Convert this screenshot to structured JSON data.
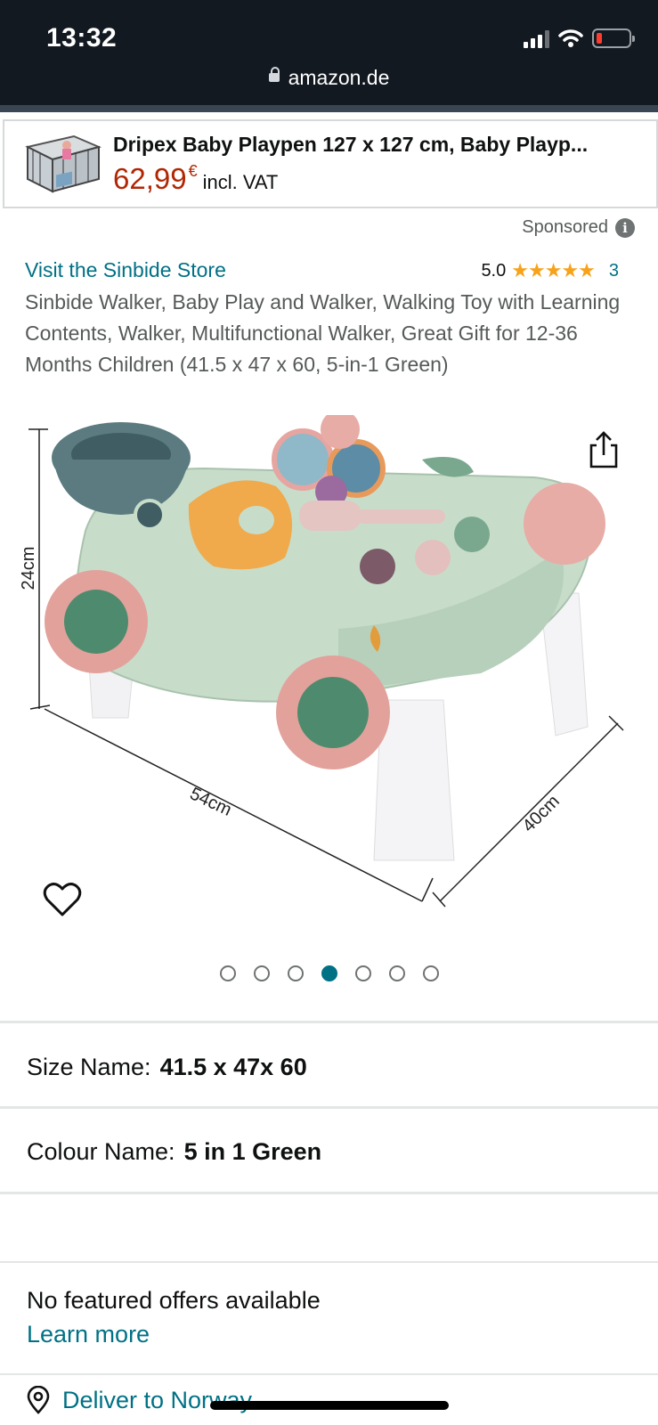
{
  "status_bar": {
    "time": "13:32"
  },
  "url_bar": {
    "domain": "amazon.de"
  },
  "ad": {
    "title": "Dripex Baby Playpen 127 x 127 cm, Baby Playp...",
    "price": "62,99",
    "currency": "€",
    "vat": "incl. VAT"
  },
  "sponsored": {
    "label": "Sponsored",
    "icon": "info-icon"
  },
  "product": {
    "store_link": "Visit the Sinbide Store",
    "rating_value": "5.0",
    "stars": "★★★★★",
    "rating_count": "3",
    "title": "Sinbide Walker, Baby Play and Walker, Walking Toy with Learning Contents, Walker, Multifunctional Walker, Great Gift for 12-36 Months Children (41.5 x 47 x 60, 5-in-1 Green)"
  },
  "image": {
    "dim_height": "24cm",
    "dim_length": "54cm",
    "dim_width": "40cm",
    "carousel_total": 7,
    "carousel_active": 4
  },
  "variations": {
    "size_label": "Size Name:",
    "size_value": "41.5 x 47x 60",
    "colour_label": "Colour Name:",
    "colour_value": "5 in 1 Green"
  },
  "offers": {
    "message": "No featured offers available",
    "learn_more": "Learn more"
  },
  "delivery": {
    "label": "Deliver to Norway",
    "icon": "location-pin-icon"
  },
  "colors": {
    "link": "#007185",
    "price": "#b12704",
    "star": "#f7a21b",
    "topbar": "#131921"
  }
}
